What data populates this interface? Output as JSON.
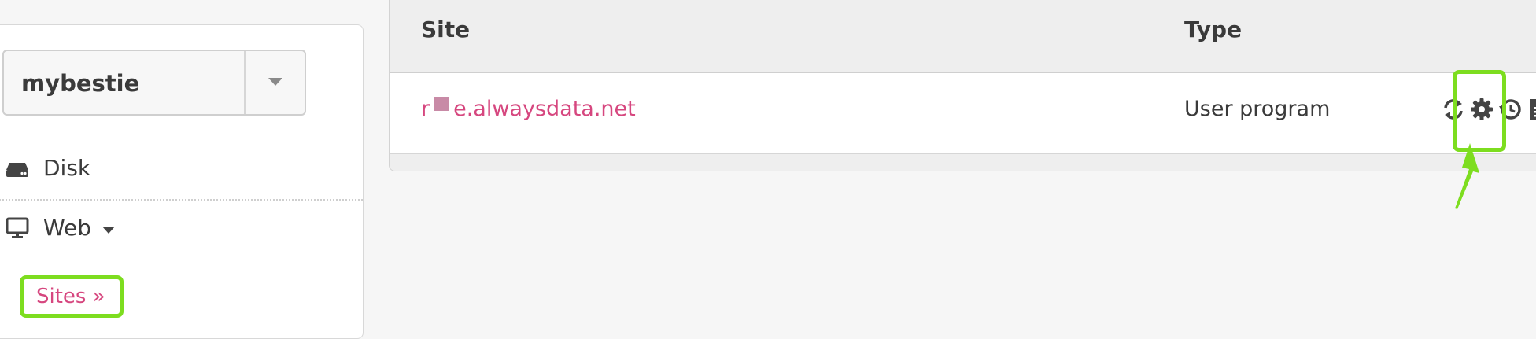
{
  "sidebar": {
    "account": {
      "name": "mybestie",
      "dropdown_icon": "caret-down-icon"
    },
    "items": [
      {
        "label": "Disk",
        "icon": "hdd-icon"
      },
      {
        "label": "Web",
        "icon": "monitor-icon",
        "expanded": true
      }
    ],
    "sub_items": [
      {
        "label": "Sites »",
        "active": true
      }
    ]
  },
  "sites_table": {
    "columns": [
      "Site",
      "Type"
    ],
    "rows": [
      {
        "site_prefix": "r",
        "site_suffix": "e.alwaysdata.net",
        "type": "User program",
        "actions": [
          "restart-icon",
          "settings-gear-icon",
          "history-icon",
          "logs-icon"
        ]
      }
    ]
  },
  "colors": {
    "link": "#d6477f",
    "annotation": "#7ddd1f",
    "text": "#3a3a3a",
    "page_background": "#f6f6f6"
  }
}
